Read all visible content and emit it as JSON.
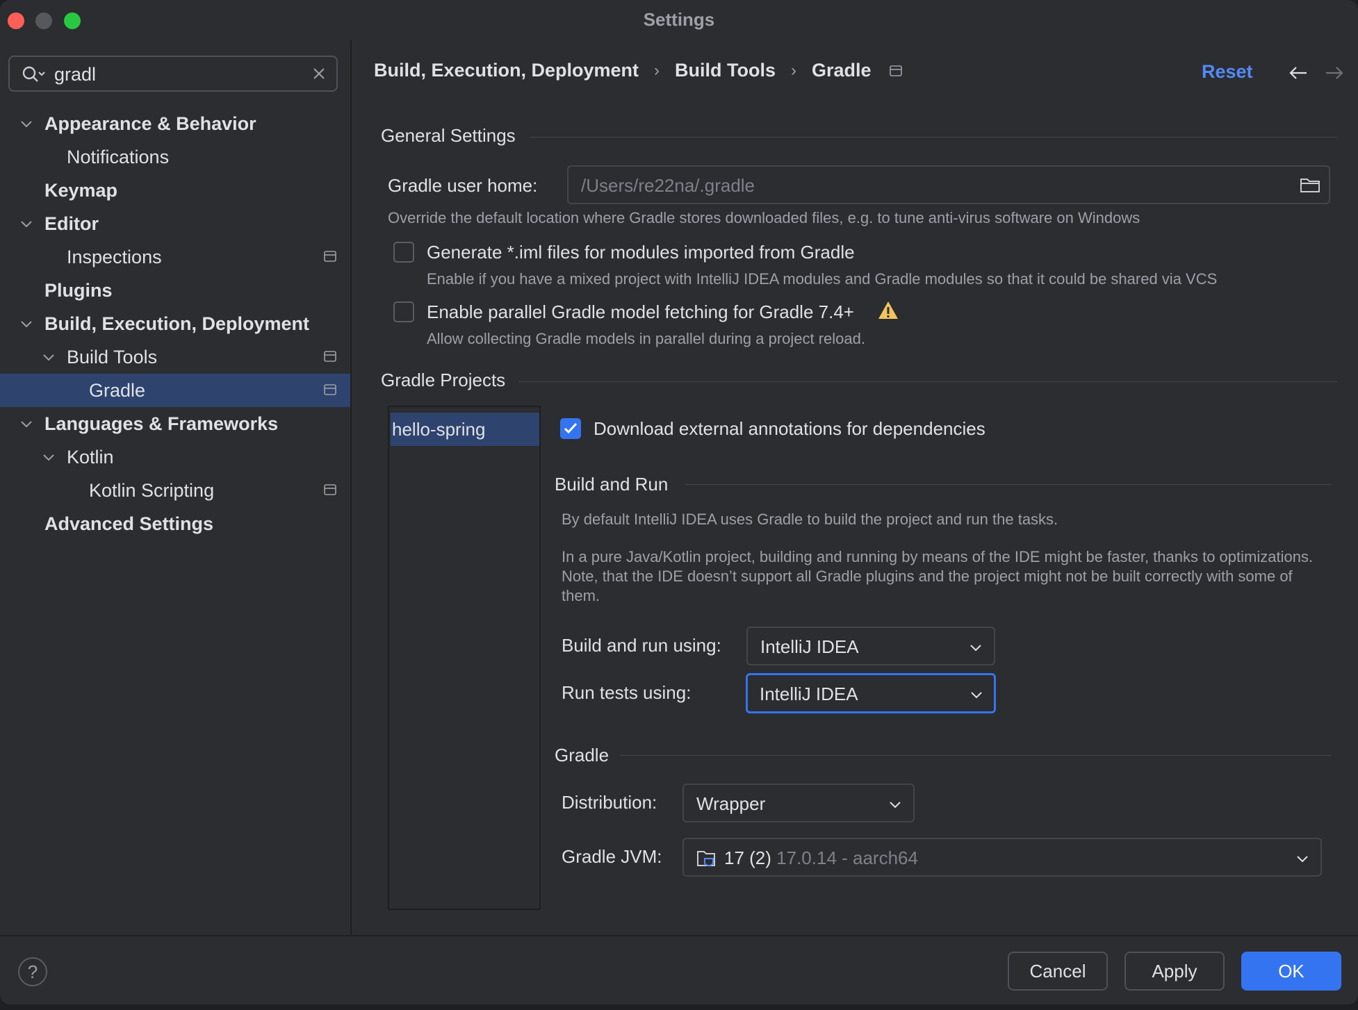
{
  "window": {
    "title": "Settings"
  },
  "search": {
    "value": "gradl"
  },
  "sidebar": {
    "items": [
      {
        "label": "Appearance & Behavior"
      },
      {
        "label": "Notifications"
      },
      {
        "label": "Keymap"
      },
      {
        "label": "Editor"
      },
      {
        "label": "Inspections"
      },
      {
        "label": "Plugins"
      },
      {
        "label": "Build, Execution, Deployment"
      },
      {
        "label": "Build Tools"
      },
      {
        "label": "Gradle"
      },
      {
        "label": "Languages & Frameworks"
      },
      {
        "label": "Kotlin"
      },
      {
        "label": "Kotlin Scripting"
      },
      {
        "label": "Advanced Settings"
      }
    ]
  },
  "breadcrumb": {
    "items": [
      "Build, Execution, Deployment",
      "Build Tools",
      "Gradle"
    ],
    "separator": "›"
  },
  "header": {
    "reset_label": "Reset"
  },
  "general": {
    "title": "General Settings",
    "gradle_home_label": "Gradle user home:",
    "gradle_home_placeholder": "/Users/re22na/.gradle",
    "gradle_home_hint": "Override the default location where Gradle stores downloaded files, e.g. to tune anti-virus software on Windows",
    "iml_label": "Generate *.iml files for modules imported from Gradle",
    "iml_hint": "Enable if you have a mixed project with IntelliJ IDEA modules and Gradle modules so that it could be shared via VCS",
    "parallel_label": "Enable parallel Gradle model fetching for Gradle 7.4+",
    "parallel_hint": "Allow collecting Gradle models in parallel during a project reload."
  },
  "projects": {
    "title": "Gradle Projects",
    "items": [
      "hello-spring"
    ],
    "annotations_label": "Download external annotations for dependencies",
    "build_run": {
      "title": "Build and Run",
      "desc1": "By default IntelliJ IDEA uses Gradle to build the project and run the tasks.",
      "desc2": "In a pure Java/Kotlin project, building and running by means of the IDE might be faster, thanks to optimizations. Note, that the IDE doesn’t support all Gradle plugins and the project might not be built correctly with some of them.",
      "build_label": "Build and run using:",
      "build_value": "IntelliJ IDEA",
      "tests_label": "Run tests using:",
      "tests_value": "IntelliJ IDEA"
    },
    "gradle": {
      "title": "Gradle",
      "distribution_label": "Distribution:",
      "distribution_value": "Wrapper",
      "jvm_label": "Gradle JVM:",
      "jvm_value": "17 (2)",
      "jvm_detail": "17.0.14 - aarch64"
    }
  },
  "footer": {
    "help": "?",
    "cancel": "Cancel",
    "apply": "Apply",
    "ok": "OK"
  },
  "colors": {
    "accent": "#3574f0",
    "selection": "#2e436e",
    "link": "#548af7",
    "warning": "#f2c55c"
  }
}
